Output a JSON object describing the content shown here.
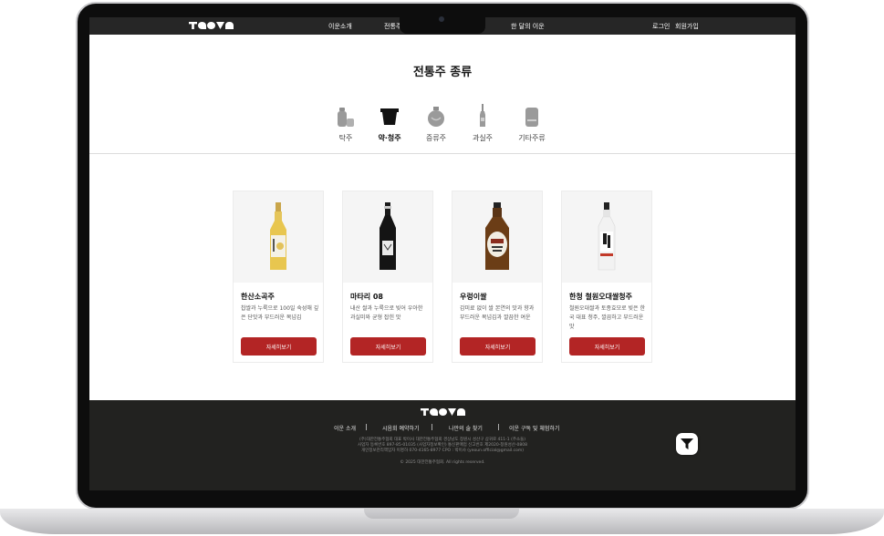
{
  "header": {
    "nav": [
      "이운소개",
      "전통주",
      "한 달의 이운"
    ],
    "login": "로그인",
    "signup": "회원가입"
  },
  "page_title": "전통주 종류",
  "categories": [
    {
      "label": "탁주",
      "icon": "makgeolli-icon",
      "active": false
    },
    {
      "label": "약·청주",
      "icon": "cheongju-bowl-icon",
      "active": true
    },
    {
      "label": "증류주",
      "icon": "soju-jar-icon",
      "active": false
    },
    {
      "label": "과실주",
      "icon": "wine-bottle-icon",
      "active": false
    },
    {
      "label": "기타주류",
      "icon": "etc-bottle-icon",
      "active": false
    }
  ],
  "products": [
    {
      "name": "한산소곡주",
      "desc": "찹쌀과 누룩으로 100일 숙성해 깊은 단맛과 부드러운 목넘김",
      "button": "자세히보기"
    },
    {
      "name": "마타리 08",
      "desc": "내산 쌀과 누룩으로 빚어 우아한 과실미와 균형 잡힌 맛",
      "button": "자세히보기"
    },
    {
      "name": "우렁이쌀",
      "desc": "감미료 없이 쌀 본연의 맛과 향과 부드러운 목넘김과 깔끔한 여운",
      "button": "자세히보기"
    },
    {
      "name": "한청 철원오대쌀청주",
      "desc": "철원오대쌀과 토종효모로 빚은 한국 대표 청주, 깔끔하고 부드러운 맛",
      "button": "자세히보기"
    }
  ],
  "footer": {
    "nav": [
      "이운 소개",
      "시음회 예약하기",
      "나만의 술 찾기",
      "이운 구독 및 체험하기"
    ],
    "info_line1": "(주)대한전통주협회 대표 박이사 대한전통주협회 경상남도 창원시 성산구 삼귀로 411-1 (주소들)",
    "info_line2": "사업자 등록번호 897-85-01035 (사업자정보확인) 통신판매업 신고번호 제2020-창원성산-0808",
    "info_line3": "개인정보관리책임자 이명하 070-4165-8977 CPO : 박이사 (yeoun.official@gmail.com)",
    "copyright": "© 2025 대한전통주협회. All rights reserved."
  },
  "colors": {
    "accent": "#b32525",
    "header_bg": "#262626",
    "footer_bg": "#222220"
  }
}
